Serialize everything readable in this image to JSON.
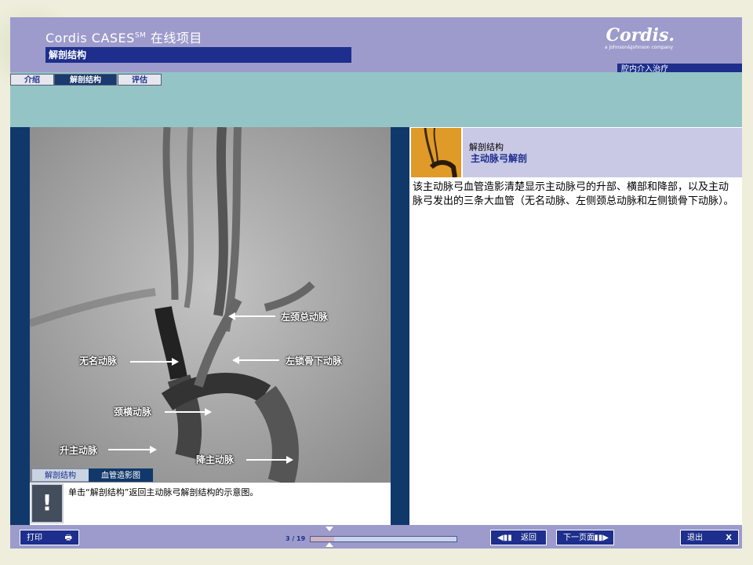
{
  "app": {
    "title": "Cordis CASES",
    "title_sup": "SM",
    "title_suffix": " 在线项目",
    "section": "解剖结构",
    "logo": "Cordis.",
    "logo_sub": "a Johnson&Johnson company",
    "category": "腔内介入治疗"
  },
  "tabs": [
    {
      "label": "介绍",
      "active": false
    },
    {
      "label": "解剖结构",
      "active": true
    },
    {
      "label": "评估",
      "active": false
    }
  ],
  "image": {
    "labels": {
      "lcca": "左颈总动脉",
      "innominate": "无名动脉",
      "lsa": "左锁骨下动脉",
      "transverse": "颈横动脉",
      "ascending": "升主动脉",
      "descending": "降主动脉"
    },
    "subtabs": [
      "解剖结构",
      "血管造影图"
    ]
  },
  "note": {
    "icon": "!",
    "text": "单击“解剖结构”返回主动脉弓解剖结构的示意图。"
  },
  "info": {
    "subtitle": "解剖结构",
    "title": "主动脉弓解剖",
    "description": "该主动脉弓血管造影清楚显示主动脉弓的升部、横部和降部，以及主动脉弓发出的三条大血管（无名动脉、左侧颈总动脉和左侧锁骨下动脉）。"
  },
  "footer": {
    "print": "打印",
    "page": "3 / 19",
    "progress": 0.16,
    "back": "返回",
    "next": "下一页面",
    "exit": "退出",
    "exit_x": "X"
  },
  "colors": {
    "header": "#9c9bcb",
    "navy": "#1d2e8c",
    "rail": "#11386a",
    "teal": "#94c4c6"
  }
}
